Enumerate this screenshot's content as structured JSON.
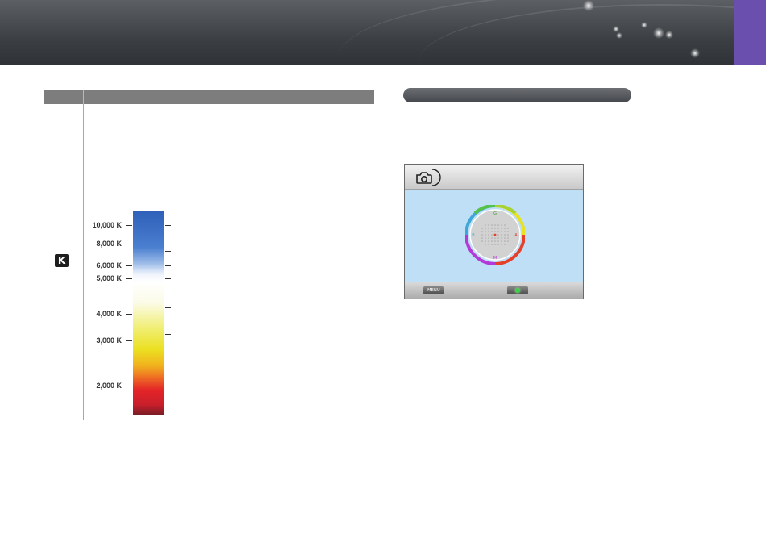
{
  "colors": {
    "accent_tab": "#6a4fae",
    "banner": "#3c4044",
    "table_header": "#7d7d7d",
    "screen_bg": "#bedff5"
  },
  "table": {
    "icon_letter": "K",
    "icon_name": "kelvin-icon"
  },
  "color_temperature": {
    "labels": [
      "10,000 K",
      "8,000 K",
      "6,000 K",
      "5,000 K",
      "4,000 K",
      "3,000 K",
      "2,000 K"
    ]
  },
  "camera_screen": {
    "title_icon": "camera-settings-icon",
    "menu_label": "MENU",
    "ok_icon": "green-ok-button-icon",
    "wheel_letters": [
      "G",
      "A",
      "M",
      "B"
    ]
  }
}
